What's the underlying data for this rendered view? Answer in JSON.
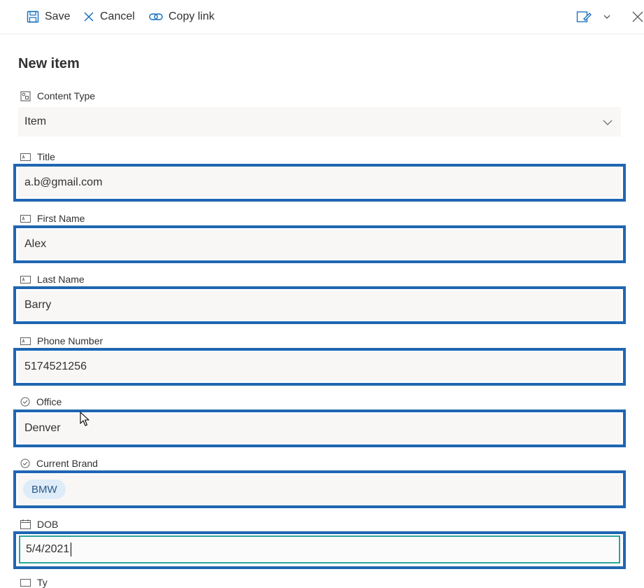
{
  "toolbar": {
    "save_label": "Save",
    "cancel_label": "Cancel",
    "copy_link_label": "Copy link"
  },
  "panel": {
    "title": "New item"
  },
  "fields": {
    "content_type": {
      "label": "Content Type",
      "value": "Item"
    },
    "title": {
      "label": "Title",
      "value": "a.b@gmail.com"
    },
    "first_name": {
      "label": "First Name",
      "value": "Alex"
    },
    "last_name": {
      "label": "Last Name",
      "value": "Barry"
    },
    "phone": {
      "label": "Phone Number",
      "value": "5174521256"
    },
    "office": {
      "label": "Office",
      "value": "Denver"
    },
    "current_brand": {
      "label": "Current Brand",
      "value": "BMW"
    },
    "dob": {
      "label": "DOB",
      "value": "5/4/2021"
    },
    "next": {
      "label": "Ty"
    }
  },
  "colors": {
    "highlight_border": "#1f66b2",
    "focus_border": "#29a59b",
    "field_background": "#f8f7f6",
    "pill_background": "#deecf9"
  }
}
